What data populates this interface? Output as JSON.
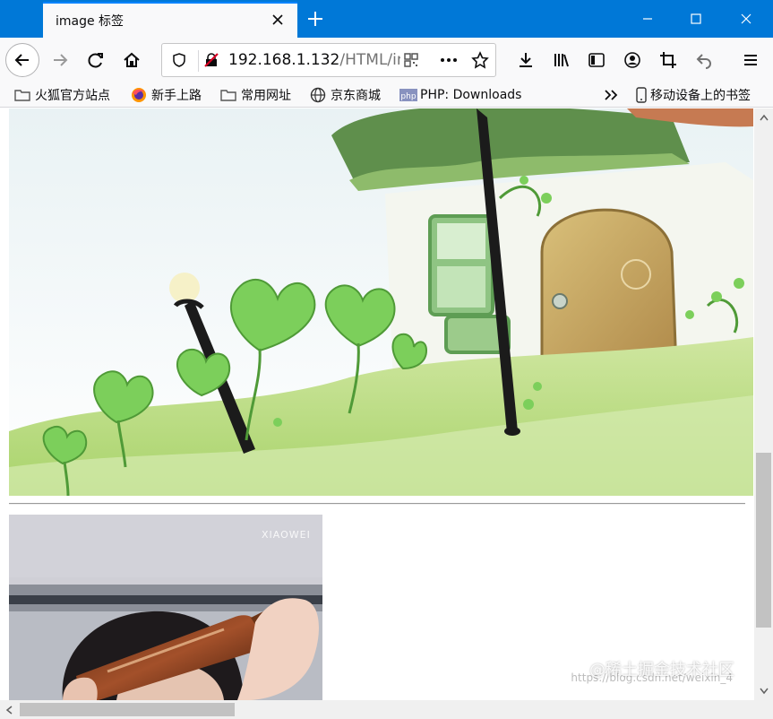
{
  "browser": {
    "tab_title": "image 标签",
    "url_host": "192.168.1.132",
    "url_path": "/HTML/in"
  },
  "bookmarks": [
    {
      "label": "火狐官方站点",
      "icon": "folder-icon"
    },
    {
      "label": "新手上路",
      "icon": "firefox-icon"
    },
    {
      "label": "常用网址",
      "icon": "folder-icon"
    },
    {
      "label": "京东商城",
      "icon": "globe-icon"
    },
    {
      "label": "PHP: Downloads",
      "icon": "php-icon"
    },
    {
      "label": "移动设备上的书签",
      "icon": "mobile-icon"
    }
  ],
  "page": {
    "image2_caption": "XIAOWEI"
  },
  "watermark": {
    "main": "@稀土掘金技术社区",
    "sub": "https://blog.csdn.net/weixin_4"
  },
  "colors": {
    "titlebar": "#0078d7",
    "toolbar": "#f9f9fa",
    "scrollbar_thumb": "#c2c2c2"
  }
}
